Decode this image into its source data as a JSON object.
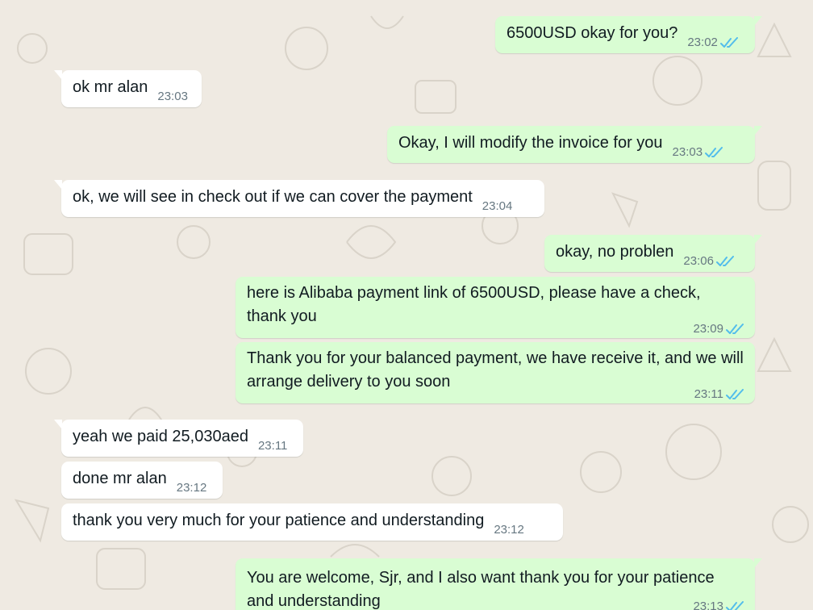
{
  "colors": {
    "background": "#efeae2",
    "incoming_bubble": "#ffffff",
    "outgoing_bubble": "#d9fdd3",
    "timestamp": "#667781",
    "read_ticks": "#53bdeb"
  },
  "messages": [
    {
      "direction": "out",
      "text": "6500USD okay for you?",
      "time": "23:02",
      "status": "read",
      "ticks_icon": "double-check-icon"
    },
    {
      "direction": "in",
      "text": "ok mr alan",
      "time": "23:03"
    },
    {
      "direction": "out",
      "text": "Okay, I will modify the invoice for you",
      "time": "23:03",
      "status": "read",
      "ticks_icon": "double-check-icon"
    },
    {
      "direction": "in",
      "text": "ok, we will see in check out if we can cover the payment",
      "time": "23:04"
    },
    {
      "direction": "out",
      "text": "okay, no problen",
      "time": "23:06",
      "status": "read",
      "ticks_icon": "double-check-icon"
    },
    {
      "direction": "out",
      "text": "here is Alibaba payment link of 6500USD, please have a check, thank you",
      "time": "23:09",
      "status": "read",
      "ticks_icon": "double-check-icon"
    },
    {
      "direction": "out",
      "text": "Thank you for your balanced payment, we have receive it, and we will arrange delivery to you soon",
      "time": "23:11",
      "status": "read",
      "ticks_icon": "double-check-icon"
    },
    {
      "direction": "in",
      "text": "yeah we paid 25,030aed",
      "time": "23:11"
    },
    {
      "direction": "in",
      "text": "done mr alan",
      "time": "23:12"
    },
    {
      "direction": "in",
      "text": "thank you very much for your patience and understanding",
      "time": "23:12"
    },
    {
      "direction": "out",
      "text": "You are welcome, Sjr, and I also want thank you for your patience and understanding",
      "time": "23:13",
      "status": "read",
      "ticks_icon": "double-check-icon"
    }
  ]
}
